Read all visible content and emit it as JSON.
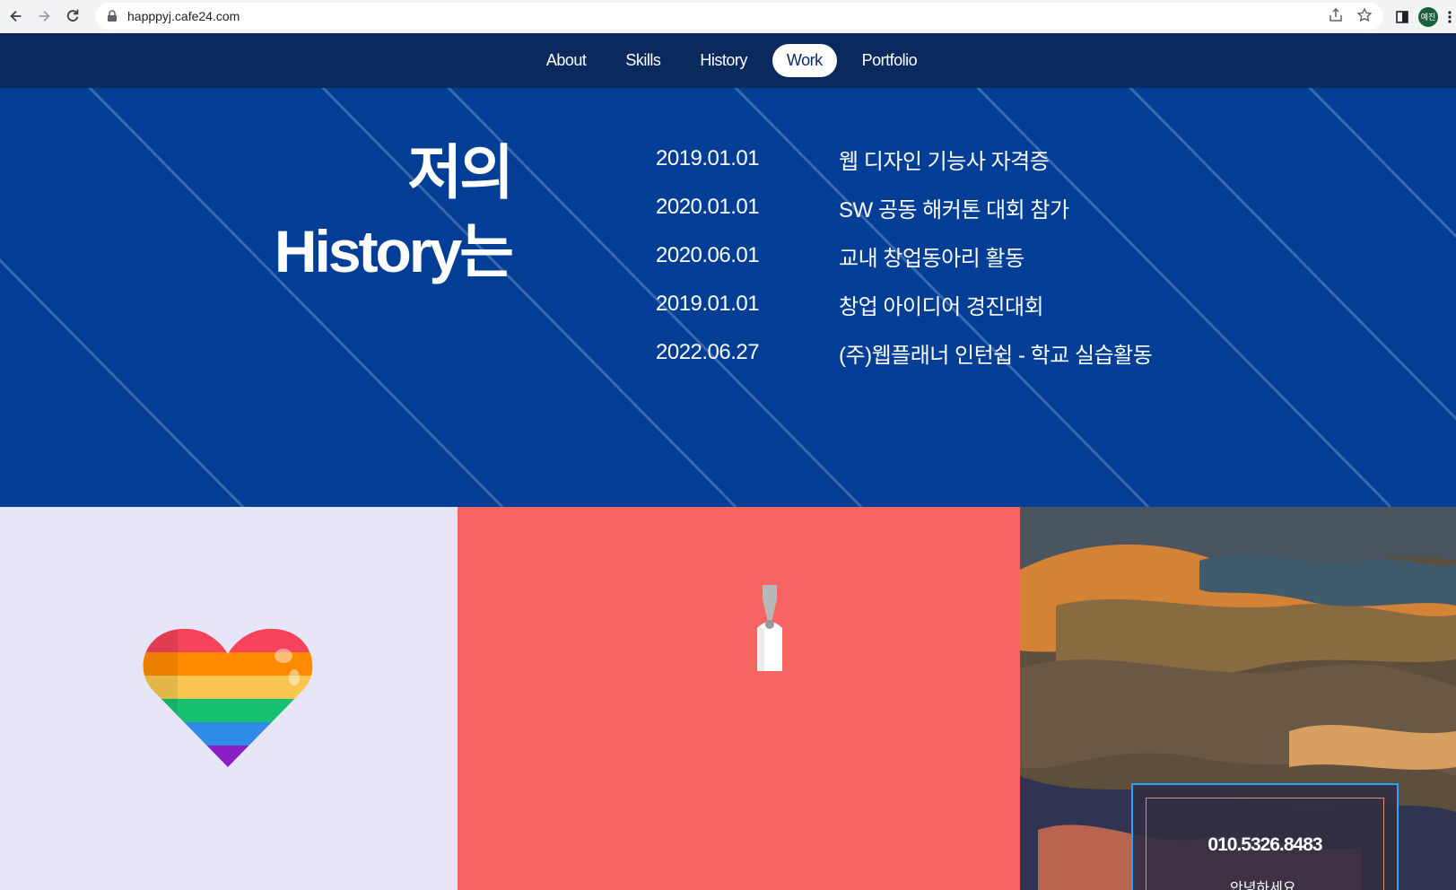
{
  "browser": {
    "url": "happpyj.cafe24.com",
    "profile_initials": "예진"
  },
  "nav": {
    "items": [
      "About",
      "Skills",
      "History",
      "Work",
      "Portfolio"
    ],
    "active": "Work"
  },
  "history": {
    "title_line1": "저의",
    "title_line2": "History는",
    "entries": [
      {
        "date": "2019.01.01",
        "text": "웹 디자인 기능사 자격증"
      },
      {
        "date": "2020.01.01",
        "text": "SW 공동 해커톤 대회 참가"
      },
      {
        "date": "2020.06.01",
        "text": "교내 창업동아리 활동"
      },
      {
        "date": "2019.01.01",
        "text": "창업 아이디어 경진대회"
      },
      {
        "date": "2022.06.27",
        "text": "(주)웹플래너 인턴쉽 - 학교 실습활동"
      }
    ]
  },
  "contact": {
    "phone": "010.5326.8483",
    "greeting": "안녕하세요."
  },
  "colors": {
    "nav_bg": "#0a2a5e",
    "history_bg": "#023e96",
    "card_heart_bg": "#e6e6f8",
    "card_coral_bg": "#f66464",
    "contact_border": "#2aa3ff"
  },
  "icons": {
    "card1": "rainbow-heart-icon",
    "card2": "price-tag-icon"
  }
}
